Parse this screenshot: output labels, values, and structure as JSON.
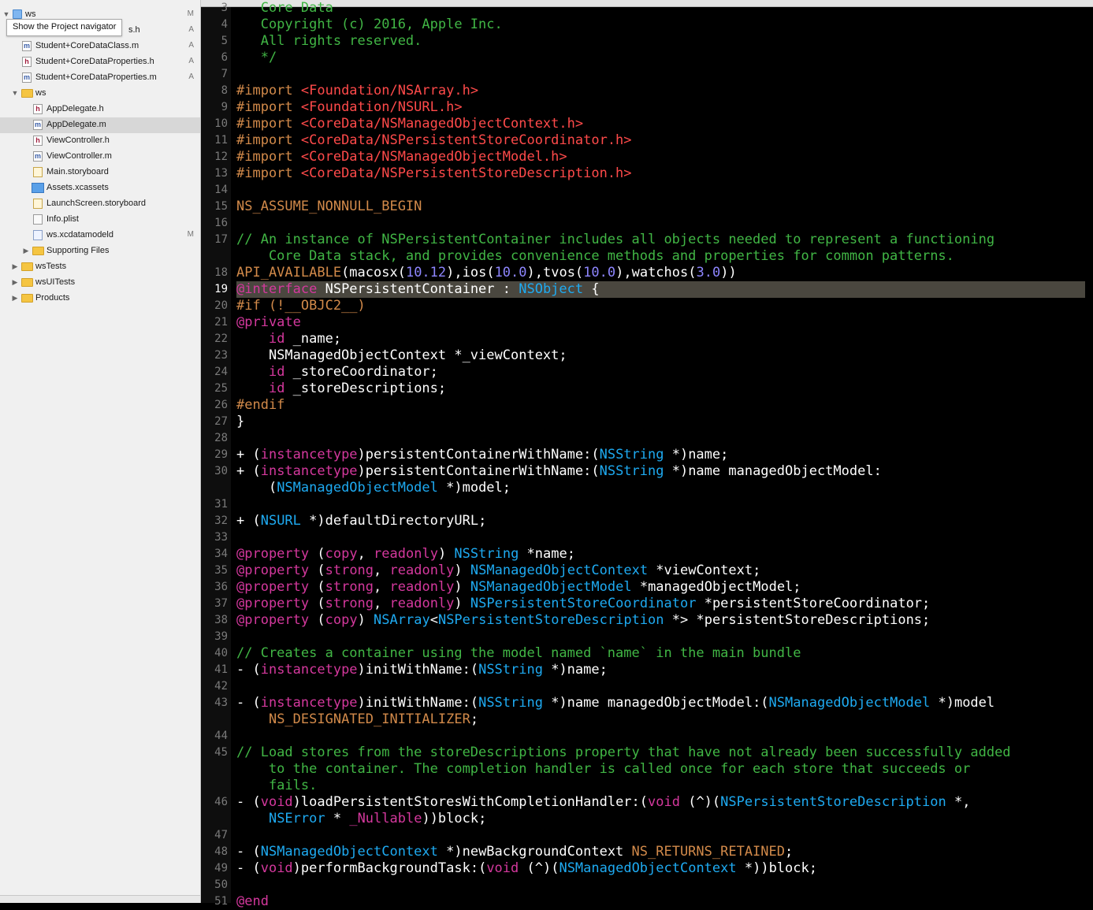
{
  "colors": {
    "comment": "#41B645",
    "directive": "#D28A4A",
    "include_path": "#FF4A4A",
    "keyword": "#D4389D",
    "type": "#1EAAF1",
    "number": "#8E86FF",
    "plain": "#FFFFFF",
    "current_line_highlight": "#4A473F",
    "navigator_background": "#F0F0F0"
  },
  "navigator": {
    "tooltip": "Show the Project navigator",
    "items": [
      {
        "label": "ws",
        "icon": "project-icon",
        "disclosure": "expanded",
        "badge": "M",
        "selected": false
      },
      {
        "label": "Student+CoreDataClass.h",
        "visible_label": "s.h",
        "icon": "header-file-icon",
        "badge": "A",
        "selected": false
      },
      {
        "label": "Student+CoreDataClass.m",
        "icon": "implementation-file-icon",
        "badge": "A",
        "selected": false
      },
      {
        "label": "Student+CoreDataProperties.h",
        "icon": "header-file-icon",
        "badge": "A",
        "selected": false
      },
      {
        "label": "Student+CoreDataProperties.m",
        "icon": "implementation-file-icon",
        "badge": "A",
        "selected": false
      },
      {
        "label": "ws",
        "icon": "folder-icon",
        "disclosure": "expanded",
        "badge": "",
        "selected": false
      },
      {
        "label": "AppDelegate.h",
        "icon": "header-file-icon",
        "badge": "",
        "selected": false
      },
      {
        "label": "AppDelegate.m",
        "icon": "implementation-file-icon",
        "badge": "",
        "selected": true
      },
      {
        "label": "ViewController.h",
        "icon": "header-file-icon",
        "badge": "",
        "selected": false
      },
      {
        "label": "ViewController.m",
        "icon": "implementation-file-icon",
        "badge": "",
        "selected": false
      },
      {
        "label": "Main.storyboard",
        "icon": "storyboard-icon",
        "badge": "",
        "selected": false
      },
      {
        "label": "Assets.xcassets",
        "icon": "asset-catalog-icon",
        "badge": "",
        "selected": false
      },
      {
        "label": "LaunchScreen.storyboard",
        "icon": "storyboard-icon",
        "badge": "",
        "selected": false
      },
      {
        "label": "Info.plist",
        "icon": "plist-icon",
        "badge": "",
        "selected": false
      },
      {
        "label": "ws.xcdatamodeld",
        "icon": "data-model-icon",
        "badge": "M",
        "selected": false
      },
      {
        "label": "Supporting Files",
        "icon": "folder-icon",
        "disclosure": "collapsed",
        "badge": "",
        "selected": false
      },
      {
        "label": "wsTests",
        "icon": "folder-icon",
        "disclosure": "collapsed",
        "badge": "",
        "selected": false
      },
      {
        "label": "wsUITests",
        "icon": "folder-icon",
        "disclosure": "collapsed",
        "badge": "",
        "selected": false
      },
      {
        "label": "Products",
        "icon": "folder-icon",
        "disclosure": "collapsed",
        "badge": "",
        "selected": false
      }
    ]
  },
  "editor": {
    "current_line": "19",
    "lines": [
      {
        "n": "3",
        "tokens": [
          {
            "t": "   Core Data",
            "c": "comment"
          }
        ]
      },
      {
        "n": "4",
        "tokens": [
          {
            "t": "   Copyright (c) 2016, Apple Inc.",
            "c": "comment"
          }
        ]
      },
      {
        "n": "5",
        "tokens": [
          {
            "t": "   All rights reserved.",
            "c": "comment"
          }
        ]
      },
      {
        "n": "6",
        "tokens": [
          {
            "t": "   */",
            "c": "comment"
          }
        ]
      },
      {
        "n": "7",
        "tokens": []
      },
      {
        "n": "8",
        "tokens": [
          {
            "t": "#import ",
            "c": "directive"
          },
          {
            "t": "<Foundation/NSArray.h>",
            "c": "incpath"
          }
        ]
      },
      {
        "n": "9",
        "tokens": [
          {
            "t": "#import ",
            "c": "directive"
          },
          {
            "t": "<Foundation/NSURL.h>",
            "c": "incpath"
          }
        ]
      },
      {
        "n": "10",
        "tokens": [
          {
            "t": "#import ",
            "c": "directive"
          },
          {
            "t": "<CoreData/NSManagedObjectContext.h>",
            "c": "incpath"
          }
        ]
      },
      {
        "n": "11",
        "tokens": [
          {
            "t": "#import ",
            "c": "directive"
          },
          {
            "t": "<CoreData/NSPersistentStoreCoordinator.h>",
            "c": "incpath"
          }
        ]
      },
      {
        "n": "12",
        "tokens": [
          {
            "t": "#import ",
            "c": "directive"
          },
          {
            "t": "<CoreData/NSManagedObjectModel.h>",
            "c": "incpath"
          }
        ]
      },
      {
        "n": "13",
        "tokens": [
          {
            "t": "#import ",
            "c": "directive"
          },
          {
            "t": "<CoreData/NSPersistentStoreDescription.h>",
            "c": "incpath"
          }
        ]
      },
      {
        "n": "14",
        "tokens": []
      },
      {
        "n": "15",
        "tokens": [
          {
            "t": "NS_ASSUME_NONNULL_BEGIN",
            "c": "macro"
          }
        ]
      },
      {
        "n": "16",
        "tokens": []
      },
      {
        "n": "17",
        "tokens": [
          {
            "t": "// An instance of NSPersistentContainer includes all objects needed to represent a functioning",
            "c": "comment"
          }
        ]
      },
      {
        "n": "",
        "tokens": [
          {
            "t": "    Core Data stack, and provides convenience methods and properties for common patterns.",
            "c": "comment"
          }
        ]
      },
      {
        "n": "18",
        "tokens": [
          {
            "t": "API_AVAILABLE",
            "c": "macro"
          },
          {
            "t": "(macosx(",
            "c": "plain"
          },
          {
            "t": "10.12",
            "c": "num"
          },
          {
            "t": "),ios(",
            "c": "plain"
          },
          {
            "t": "10.0",
            "c": "num"
          },
          {
            "t": "),tvos(",
            "c": "plain"
          },
          {
            "t": "10.0",
            "c": "num"
          },
          {
            "t": "),watchos(",
            "c": "plain"
          },
          {
            "t": "3.0",
            "c": "num"
          },
          {
            "t": "))",
            "c": "plain"
          }
        ]
      },
      {
        "n": "19",
        "tokens": [
          {
            "t": "@interface",
            "c": "kw"
          },
          {
            "t": " NSPersistentContainer : ",
            "c": "plain"
          },
          {
            "t": "NSObject",
            "c": "type"
          },
          {
            "t": " {",
            "c": "plain"
          }
        ]
      },
      {
        "n": "20",
        "tokens": [
          {
            "t": "#if (!__OBJC2__)",
            "c": "directive"
          }
        ]
      },
      {
        "n": "21",
        "tokens": [
          {
            "t": "@private",
            "c": "kw"
          }
        ]
      },
      {
        "n": "22",
        "tokens": [
          {
            "t": "    ",
            "c": "plain"
          },
          {
            "t": "id",
            "c": "kw"
          },
          {
            "t": " _name;",
            "c": "plain"
          }
        ]
      },
      {
        "n": "23",
        "tokens": [
          {
            "t": "    NSManagedObjectContext *_viewContext;",
            "c": "plain"
          }
        ]
      },
      {
        "n": "24",
        "tokens": [
          {
            "t": "    ",
            "c": "plain"
          },
          {
            "t": "id",
            "c": "kw"
          },
          {
            "t": " _storeCoordinator;",
            "c": "plain"
          }
        ]
      },
      {
        "n": "25",
        "tokens": [
          {
            "t": "    ",
            "c": "plain"
          },
          {
            "t": "id",
            "c": "kw"
          },
          {
            "t": " _storeDescriptions;",
            "c": "plain"
          }
        ]
      },
      {
        "n": "26",
        "tokens": [
          {
            "t": "#endif",
            "c": "directive"
          }
        ]
      },
      {
        "n": "27",
        "tokens": [
          {
            "t": "}",
            "c": "plain"
          }
        ]
      },
      {
        "n": "28",
        "tokens": []
      },
      {
        "n": "29",
        "tokens": [
          {
            "t": "+ (",
            "c": "plain"
          },
          {
            "t": "instancetype",
            "c": "kw"
          },
          {
            "t": ")persistentContainerWithName:(",
            "c": "plain"
          },
          {
            "t": "NSString",
            "c": "type"
          },
          {
            "t": " *)name;",
            "c": "plain"
          }
        ]
      },
      {
        "n": "30",
        "tokens": [
          {
            "t": "+ (",
            "c": "plain"
          },
          {
            "t": "instancetype",
            "c": "kw"
          },
          {
            "t": ")persistentContainerWithName:(",
            "c": "plain"
          },
          {
            "t": "NSString",
            "c": "type"
          },
          {
            "t": " *)name managedObjectModel:",
            "c": "plain"
          }
        ]
      },
      {
        "n": "",
        "tokens": [
          {
            "t": "    (",
            "c": "plain"
          },
          {
            "t": "NSManagedObjectModel",
            "c": "type"
          },
          {
            "t": " *)model;",
            "c": "plain"
          }
        ]
      },
      {
        "n": "31",
        "tokens": []
      },
      {
        "n": "32",
        "tokens": [
          {
            "t": "+ (",
            "c": "plain"
          },
          {
            "t": "NSURL",
            "c": "type"
          },
          {
            "t": " *)defaultDirectoryURL;",
            "c": "plain"
          }
        ]
      },
      {
        "n": "33",
        "tokens": []
      },
      {
        "n": "34",
        "tokens": [
          {
            "t": "@property",
            "c": "kw"
          },
          {
            "t": " (",
            "c": "plain"
          },
          {
            "t": "copy",
            "c": "kw"
          },
          {
            "t": ", ",
            "c": "plain"
          },
          {
            "t": "readonly",
            "c": "kw"
          },
          {
            "t": ") ",
            "c": "plain"
          },
          {
            "t": "NSString",
            "c": "type"
          },
          {
            "t": " *name;",
            "c": "plain"
          }
        ]
      },
      {
        "n": "35",
        "tokens": [
          {
            "t": "@property",
            "c": "kw"
          },
          {
            "t": " (",
            "c": "plain"
          },
          {
            "t": "strong",
            "c": "kw"
          },
          {
            "t": ", ",
            "c": "plain"
          },
          {
            "t": "readonly",
            "c": "kw"
          },
          {
            "t": ") ",
            "c": "plain"
          },
          {
            "t": "NSManagedObjectContext",
            "c": "type"
          },
          {
            "t": " *viewContext;",
            "c": "plain"
          }
        ]
      },
      {
        "n": "36",
        "tokens": [
          {
            "t": "@property",
            "c": "kw"
          },
          {
            "t": " (",
            "c": "plain"
          },
          {
            "t": "strong",
            "c": "kw"
          },
          {
            "t": ", ",
            "c": "plain"
          },
          {
            "t": "readonly",
            "c": "kw"
          },
          {
            "t": ") ",
            "c": "plain"
          },
          {
            "t": "NSManagedObjectModel",
            "c": "type"
          },
          {
            "t": " *managedObjectModel;",
            "c": "plain"
          }
        ]
      },
      {
        "n": "37",
        "tokens": [
          {
            "t": "@property",
            "c": "kw"
          },
          {
            "t": " (",
            "c": "plain"
          },
          {
            "t": "strong",
            "c": "kw"
          },
          {
            "t": ", ",
            "c": "plain"
          },
          {
            "t": "readonly",
            "c": "kw"
          },
          {
            "t": ") ",
            "c": "plain"
          },
          {
            "t": "NSPersistentStoreCoordinator",
            "c": "type"
          },
          {
            "t": " *persistentStoreCoordinator;",
            "c": "plain"
          }
        ]
      },
      {
        "n": "38",
        "tokens": [
          {
            "t": "@property",
            "c": "kw"
          },
          {
            "t": " (",
            "c": "plain"
          },
          {
            "t": "copy",
            "c": "kw"
          },
          {
            "t": ") ",
            "c": "plain"
          },
          {
            "t": "NSArray",
            "c": "type"
          },
          {
            "t": "<",
            "c": "plain"
          },
          {
            "t": "NSPersistentStoreDescription",
            "c": "type"
          },
          {
            "t": " *> *persistentStoreDescriptions;",
            "c": "plain"
          }
        ]
      },
      {
        "n": "39",
        "tokens": []
      },
      {
        "n": "40",
        "tokens": [
          {
            "t": "// Creates a container using the model named `name` in the main bundle",
            "c": "comment"
          }
        ]
      },
      {
        "n": "41",
        "tokens": [
          {
            "t": "- (",
            "c": "plain"
          },
          {
            "t": "instancetype",
            "c": "kw"
          },
          {
            "t": ")initWithName:(",
            "c": "plain"
          },
          {
            "t": "NSString",
            "c": "type"
          },
          {
            "t": " *)name;",
            "c": "plain"
          }
        ]
      },
      {
        "n": "42",
        "tokens": []
      },
      {
        "n": "43",
        "tokens": [
          {
            "t": "- (",
            "c": "plain"
          },
          {
            "t": "instancetype",
            "c": "kw"
          },
          {
            "t": ")initWithName:(",
            "c": "plain"
          },
          {
            "t": "NSString",
            "c": "type"
          },
          {
            "t": " *)name managedObjectModel:(",
            "c": "plain"
          },
          {
            "t": "NSManagedObjectModel",
            "c": "type"
          },
          {
            "t": " *)model",
            "c": "plain"
          }
        ]
      },
      {
        "n": "",
        "tokens": [
          {
            "t": "    ",
            "c": "plain"
          },
          {
            "t": "NS_DESIGNATED_INITIALIZER",
            "c": "macro"
          },
          {
            "t": ";",
            "c": "plain"
          }
        ]
      },
      {
        "n": "44",
        "tokens": []
      },
      {
        "n": "45",
        "tokens": [
          {
            "t": "// Load stores from the storeDescriptions property that have not already been successfully added",
            "c": "comment"
          }
        ]
      },
      {
        "n": "",
        "tokens": [
          {
            "t": "    to the container. The completion handler is called once for each store that succeeds or",
            "c": "comment"
          }
        ]
      },
      {
        "n": "",
        "tokens": [
          {
            "t": "    fails.",
            "c": "comment"
          }
        ]
      },
      {
        "n": "46",
        "tokens": [
          {
            "t": "- (",
            "c": "plain"
          },
          {
            "t": "void",
            "c": "kw"
          },
          {
            "t": ")loadPersistentStoresWithCompletionHandler:(",
            "c": "plain"
          },
          {
            "t": "void",
            "c": "kw"
          },
          {
            "t": " (^)(",
            "c": "plain"
          },
          {
            "t": "NSPersistentStoreDescription",
            "c": "type"
          },
          {
            "t": " *,",
            "c": "plain"
          }
        ]
      },
      {
        "n": "",
        "tokens": [
          {
            "t": "    ",
            "c": "plain"
          },
          {
            "t": "NSError",
            "c": "type"
          },
          {
            "t": " * ",
            "c": "plain"
          },
          {
            "t": "_Nullable",
            "c": "kw"
          },
          {
            "t": "))block;",
            "c": "plain"
          }
        ]
      },
      {
        "n": "47",
        "tokens": []
      },
      {
        "n": "48",
        "tokens": [
          {
            "t": "- (",
            "c": "plain"
          },
          {
            "t": "NSManagedObjectContext",
            "c": "type"
          },
          {
            "t": " *)newBackgroundContext ",
            "c": "plain"
          },
          {
            "t": "NS_RETURNS_RETAINED",
            "c": "macro"
          },
          {
            "t": ";",
            "c": "plain"
          }
        ]
      },
      {
        "n": "49",
        "tokens": [
          {
            "t": "- (",
            "c": "plain"
          },
          {
            "t": "void",
            "c": "kw"
          },
          {
            "t": ")performBackgroundTask:(",
            "c": "plain"
          },
          {
            "t": "void",
            "c": "kw"
          },
          {
            "t": " (^)(",
            "c": "plain"
          },
          {
            "t": "NSManagedObjectContext",
            "c": "type"
          },
          {
            "t": " *))block;",
            "c": "plain"
          }
        ]
      },
      {
        "n": "50",
        "tokens": []
      },
      {
        "n": "51",
        "tokens": [
          {
            "t": "@end",
            "c": "kw"
          }
        ]
      }
    ]
  }
}
